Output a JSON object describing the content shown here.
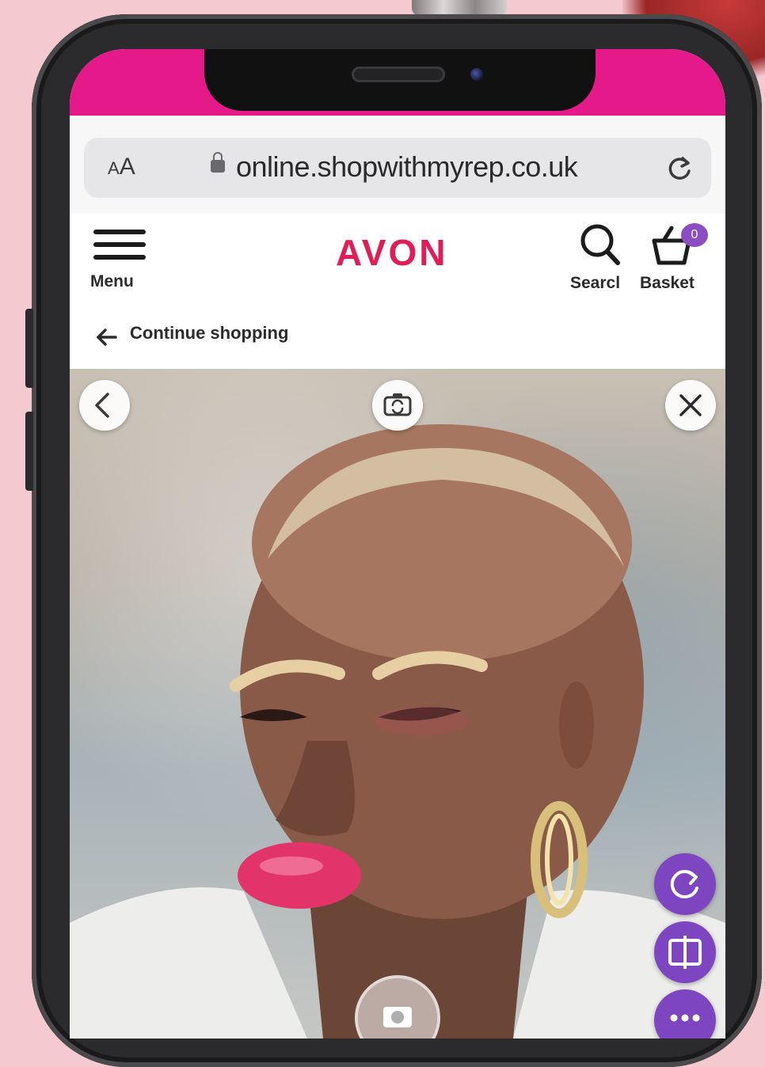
{
  "browser": {
    "text_size_label": "AA",
    "url": "online.shopwithmyrep.co.uk"
  },
  "header": {
    "menu_label": "Menu",
    "brand": "AVON",
    "search_label": "Searcl",
    "basket_label": "Basket",
    "basket_count": "0"
  },
  "nav": {
    "continue_label": "Continue shopping"
  },
  "colors": {
    "brand_pink": "#e6198a",
    "logo_red": "#e31c56",
    "action_purple": "#7e45c0"
  }
}
